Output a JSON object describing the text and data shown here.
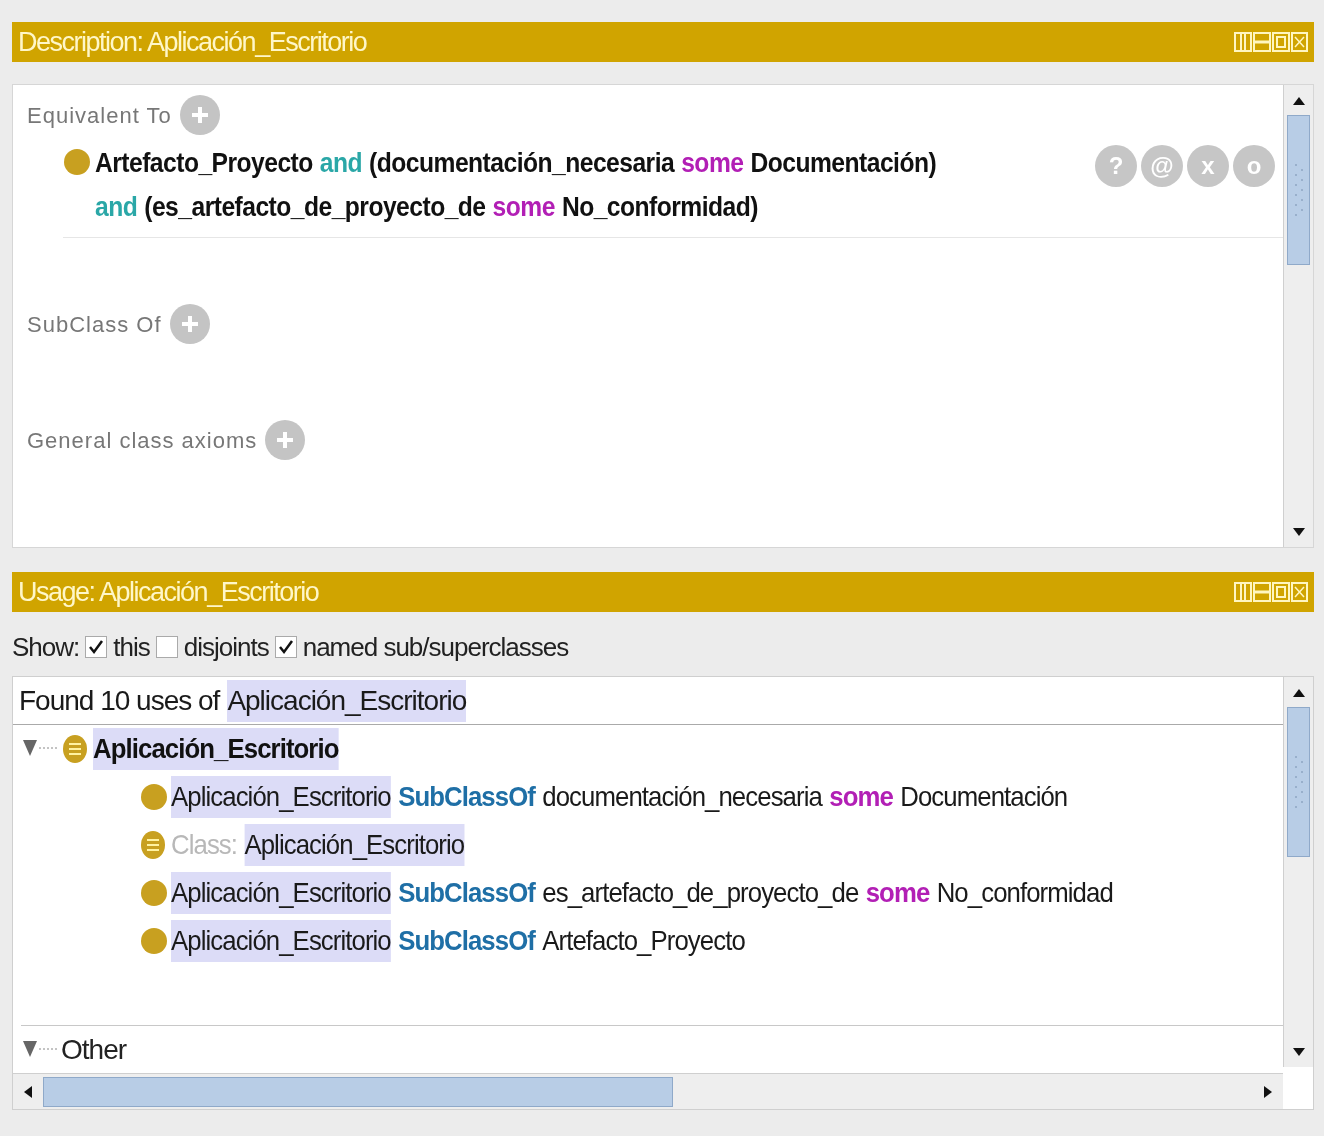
{
  "description_panel": {
    "title": "Description: Aplicación_Escritorio",
    "sections": [
      {
        "label": "Equivalent To",
        "axioms": [
          {
            "lines": [
              [
                {
                  "text": "Artefacto_Proyecto",
                  "kind": "name"
                },
                {
                  "text": "and",
                  "kind": "logic"
                },
                {
                  "text": "(documentación_necesaria",
                  "kind": "name"
                },
                {
                  "text": "some",
                  "kind": "quantifier"
                },
                {
                  "text": "Documentación)",
                  "kind": "name"
                }
              ],
              [
                {
                  "text": "and",
                  "kind": "logic"
                },
                {
                  "text": "(es_artefacto_de_proyecto_de",
                  "kind": "name"
                },
                {
                  "text": "some",
                  "kind": "quantifier"
                },
                {
                  "text": "No_conformidad)",
                  "kind": "name"
                }
              ]
            ],
            "buttons": [
              "?",
              "@",
              "x",
              "o"
            ]
          }
        ]
      },
      {
        "label": "SubClass Of"
      },
      {
        "label": "General class axioms"
      }
    ]
  },
  "usage_panel": {
    "title": "Usage: Aplicación_Escritorio",
    "show_label": "Show:",
    "filters": [
      {
        "label": "this",
        "checked": true
      },
      {
        "label": "disjoints",
        "checked": false
      },
      {
        "label": "named sub/superclasses",
        "checked": true
      }
    ],
    "summary": [
      {
        "text": "Found 10 uses of",
        "highlighted": false
      },
      {
        "text": "Aplicación_Escritorio",
        "highlighted": true
      }
    ],
    "tree": [
      {
        "kind": "class",
        "label": "Aplicación_Escritorio",
        "expanded": true,
        "children": [
          {
            "kind": "axiom",
            "tokens": [
              {
                "text": "Aplicación_Escritorio",
                "kind": "plain",
                "highlighted": true
              },
              {
                "text": "SubClassOf",
                "kind": "keyword",
                "highlighted": false
              },
              {
                "text": "documentación_necesaria",
                "kind": "plain",
                "highlighted": false
              },
              {
                "text": "some",
                "kind": "quantifier",
                "highlighted": false
              },
              {
                "text": "Documentación",
                "kind": "plain",
                "highlighted": false
              }
            ]
          },
          {
            "kind": "declaration",
            "tokens": [
              {
                "text": "Class:",
                "kind": "muted",
                "highlighted": false
              },
              {
                "text": "Aplicación_Escritorio",
                "kind": "plain",
                "highlighted": true
              }
            ]
          },
          {
            "kind": "axiom",
            "tokens": [
              {
                "text": "Aplicación_Escritorio",
                "kind": "plain",
                "highlighted": true
              },
              {
                "text": "SubClassOf",
                "kind": "keyword",
                "highlighted": false
              },
              {
                "text": "es_artefacto_de_proyecto_de",
                "kind": "plain",
                "highlighted": false
              },
              {
                "text": "some",
                "kind": "quantifier",
                "highlighted": false
              },
              {
                "text": "No_conformidad",
                "kind": "plain",
                "highlighted": false
              }
            ]
          },
          {
            "kind": "axiom",
            "tokens": [
              {
                "text": "Aplicación_Escritorio",
                "kind": "plain",
                "highlighted": true
              },
              {
                "text": "SubClassOf",
                "kind": "keyword",
                "highlighted": false
              },
              {
                "text": "Artefacto_Proyecto",
                "kind": "plain",
                "highlighted": false
              }
            ]
          }
        ]
      },
      {
        "kind": "group",
        "label": "Other",
        "expanded": true
      }
    ]
  }
}
